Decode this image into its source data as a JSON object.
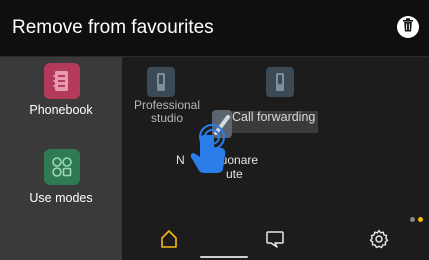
{
  "header": {
    "title": "Remove from favourites"
  },
  "sidebar": {
    "items": [
      {
        "label": "Phonebook",
        "icon": "phonebook-icon",
        "color": "#b33a5a"
      },
      {
        "label": "Use modes",
        "icon": "use-modes-icon",
        "color": "#2f7a55"
      }
    ]
  },
  "favourites": {
    "tiles": [
      {
        "label": "Professional\nstudio",
        "icon": "intercom-icon"
      },
      {
        "label": "Call forwarding",
        "icon": "intercom-icon"
      }
    ],
    "dragged_label": "Call forwarding",
    "dimmed_label": "N         suonare\n               ute"
  },
  "page_dots": {
    "active_color": "#f2b90f",
    "inactive_color": "#8a8a8a"
  },
  "nav": {
    "items": [
      {
        "icon": "home-icon",
        "active": true,
        "color": "#f2b90f"
      },
      {
        "icon": "message-icon",
        "active": false,
        "color": "#e8e8e8"
      },
      {
        "icon": "settings-icon",
        "active": false,
        "color": "#e8e8e8"
      }
    ]
  }
}
